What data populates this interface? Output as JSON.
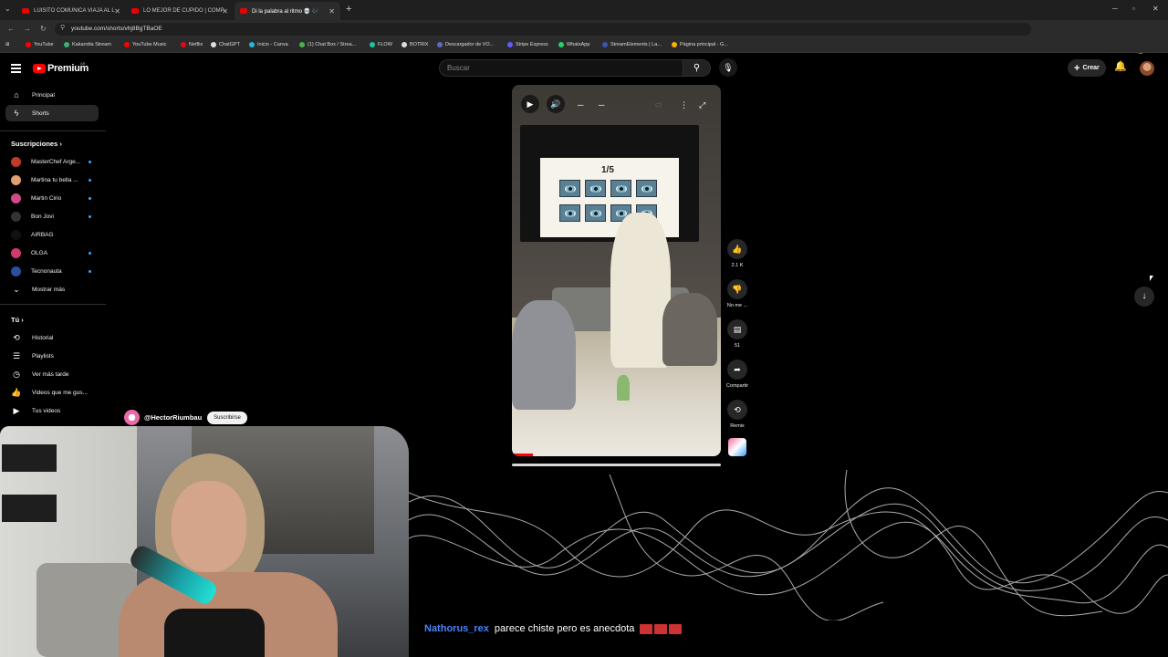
{
  "browser": {
    "tabs": [
      {
        "title": "LUISITO COMUNICA VIAJA AL L"
      },
      {
        "title": "LO MEJOR DE CUPIDO | COMP"
      },
      {
        "title": "Di la palabra al ritmo 💀 🎶"
      }
    ],
    "url": "youtube.com/shorts/vhj8BgTBaOE",
    "bookmarks": [
      {
        "label": "YouTube",
        "color": "#ff0000"
      },
      {
        "label": "Kakarotta Stream",
        "color": "#3cb371"
      },
      {
        "label": "YouTube Music",
        "color": "#ff0000"
      },
      {
        "label": "Netflix",
        "color": "#e50914"
      },
      {
        "label": "ChatGPT",
        "color": "#dddddd"
      },
      {
        "label": "Inicio - Canva",
        "color": "#23b7d8"
      },
      {
        "label": "(1) Chat Box / Strea...",
        "color": "#4caf50"
      },
      {
        "label": "FLOW",
        "color": "#22c1a4"
      },
      {
        "label": "BOTRIX",
        "color": "#dddddd"
      },
      {
        "label": "Descargador de VO...",
        "color": "#5c6bc0"
      },
      {
        "label": "Stripe Express",
        "color": "#635bff"
      },
      {
        "label": "WhatsApp",
        "color": "#25d366"
      },
      {
        "label": "StreamElements | La...",
        "color": "#3f51b5"
      },
      {
        "label": "Página principal - G...",
        "color": "#f4b400"
      }
    ]
  },
  "masthead": {
    "brand": "Premium",
    "country": "AR",
    "search_placeholder": "Buscar",
    "create_label": "Crear"
  },
  "sidebar": {
    "main": [
      {
        "label": "Principal",
        "icon": "home-icon"
      },
      {
        "label": "Shorts",
        "icon": "shorts-icon"
      }
    ],
    "subscriptions_title": "Suscripciones",
    "subscriptions": [
      {
        "label": "MasterChef Arge...",
        "color": "#c0392b",
        "live": true
      },
      {
        "label": "Martina tu bella ...",
        "color": "#e0a070",
        "live": true
      },
      {
        "label": "Martin Cirio",
        "color": "#d04a8a",
        "live": true
      },
      {
        "label": "Bon Jovi",
        "color": "#333333",
        "live": true
      },
      {
        "label": "AIRBAG",
        "color": "#111111",
        "live": false
      },
      {
        "label": "OLGA",
        "color": "#d23a6b",
        "live": true
      },
      {
        "label": "Tecnonauta",
        "color": "#2a4fa0",
        "live": true
      }
    ],
    "show_more": "Mostrar más",
    "you_title": "Tú",
    "you": [
      {
        "label": "Historial",
        "icon": "history-icon"
      },
      {
        "label": "Playlists",
        "icon": "playlist-icon"
      },
      {
        "label": "Ver más tarde",
        "icon": "clock-icon"
      },
      {
        "label": "Videos que me gus...",
        "icon": "thumbs-up-icon"
      },
      {
        "label": "Tus videos",
        "icon": "your-videos-icon"
      }
    ]
  },
  "short": {
    "counter": "1/5",
    "likes": "2.1 K",
    "dislike_label": "No me ...",
    "comments": "51",
    "share_label": "Compartir",
    "remix_label": "Remix",
    "channel": "@HectorRiumbau",
    "subscribe": "Suscribirse",
    "progress": 0.1
  },
  "chat": {
    "user": "Nathorus_rex",
    "message": "parece chiste pero es anecdota"
  }
}
